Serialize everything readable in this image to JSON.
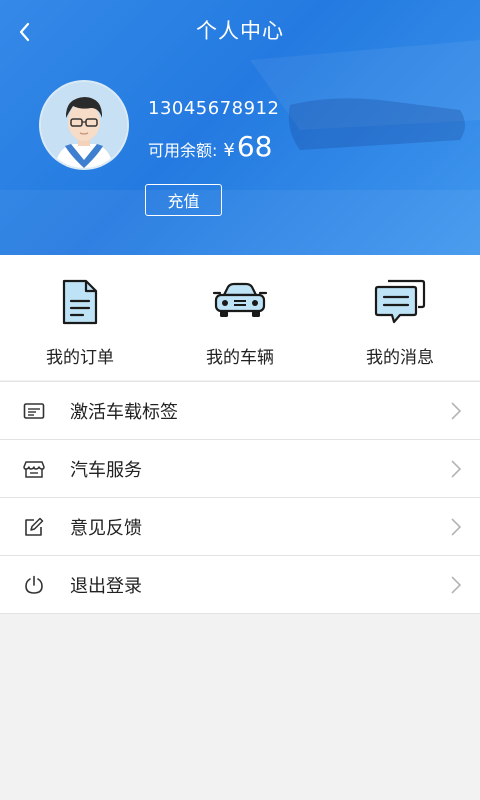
{
  "header": {
    "title": "个人中心",
    "back_icon": "chevron-left-icon",
    "background_color": "#2a84e6"
  },
  "profile": {
    "phone": "13045678912",
    "balance_label": "可用余额:",
    "currency": "¥",
    "balance_amount": "68",
    "recharge_label": "充值"
  },
  "quick_actions": [
    {
      "label": "我的订单",
      "icon": "document-icon"
    },
    {
      "label": "我的车辆",
      "icon": "car-icon"
    },
    {
      "label": "我的消息",
      "icon": "message-icon"
    }
  ],
  "menu": [
    {
      "label": "激活车载标签",
      "icon": "card-icon"
    },
    {
      "label": "汽车服务",
      "icon": "store-icon"
    },
    {
      "label": "意见反馈",
      "icon": "edit-icon"
    },
    {
      "label": "退出登录",
      "icon": "power-icon"
    }
  ]
}
